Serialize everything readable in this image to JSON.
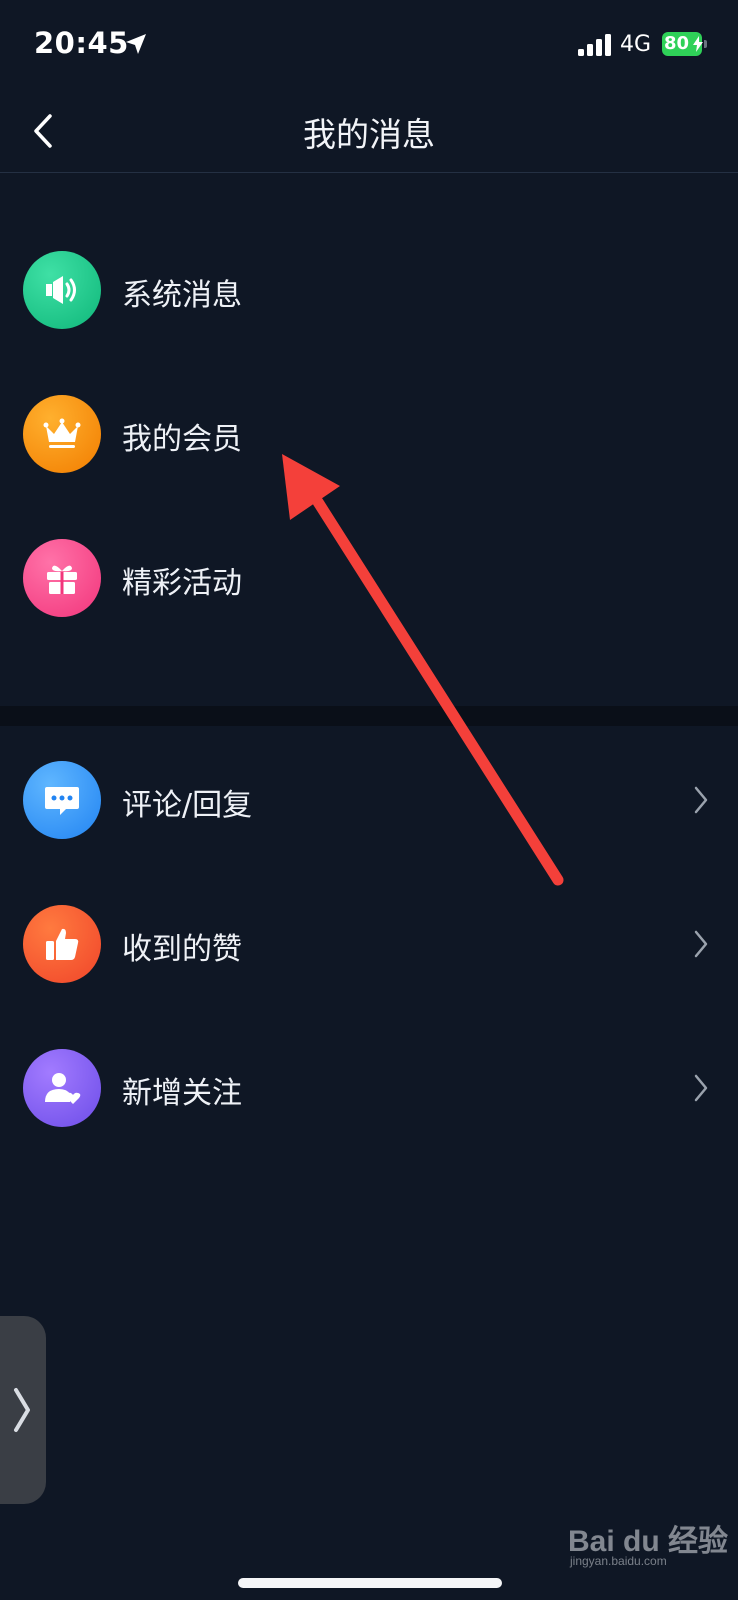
{
  "status": {
    "time": "20:45",
    "network": "4G",
    "battery": "80"
  },
  "header": {
    "title": "我的消息"
  },
  "sections": [
    {
      "items": [
        {
          "label": "系统消息",
          "icon": "speaker-icon",
          "color": "#14c98a"
        },
        {
          "label": "我的会员",
          "icon": "crown-icon",
          "color": "#ff9a0e"
        },
        {
          "label": "精彩活动",
          "icon": "gift-icon",
          "color": "#ff4d90"
        }
      ]
    },
    {
      "items": [
        {
          "label": "评论/回复",
          "icon": "comment-icon",
          "color": "#2f9bff"
        },
        {
          "label": "收到的赞",
          "icon": "thumbs-up-icon",
          "color": "#ff5a2a"
        },
        {
          "label": "新增关注",
          "icon": "add-follower-icon",
          "color": "#8a62f4"
        }
      ]
    }
  ],
  "watermark": {
    "logo": "Bai du 经验",
    "site": "jingyan.baidu.com"
  },
  "annotation_color": "#f4403a"
}
